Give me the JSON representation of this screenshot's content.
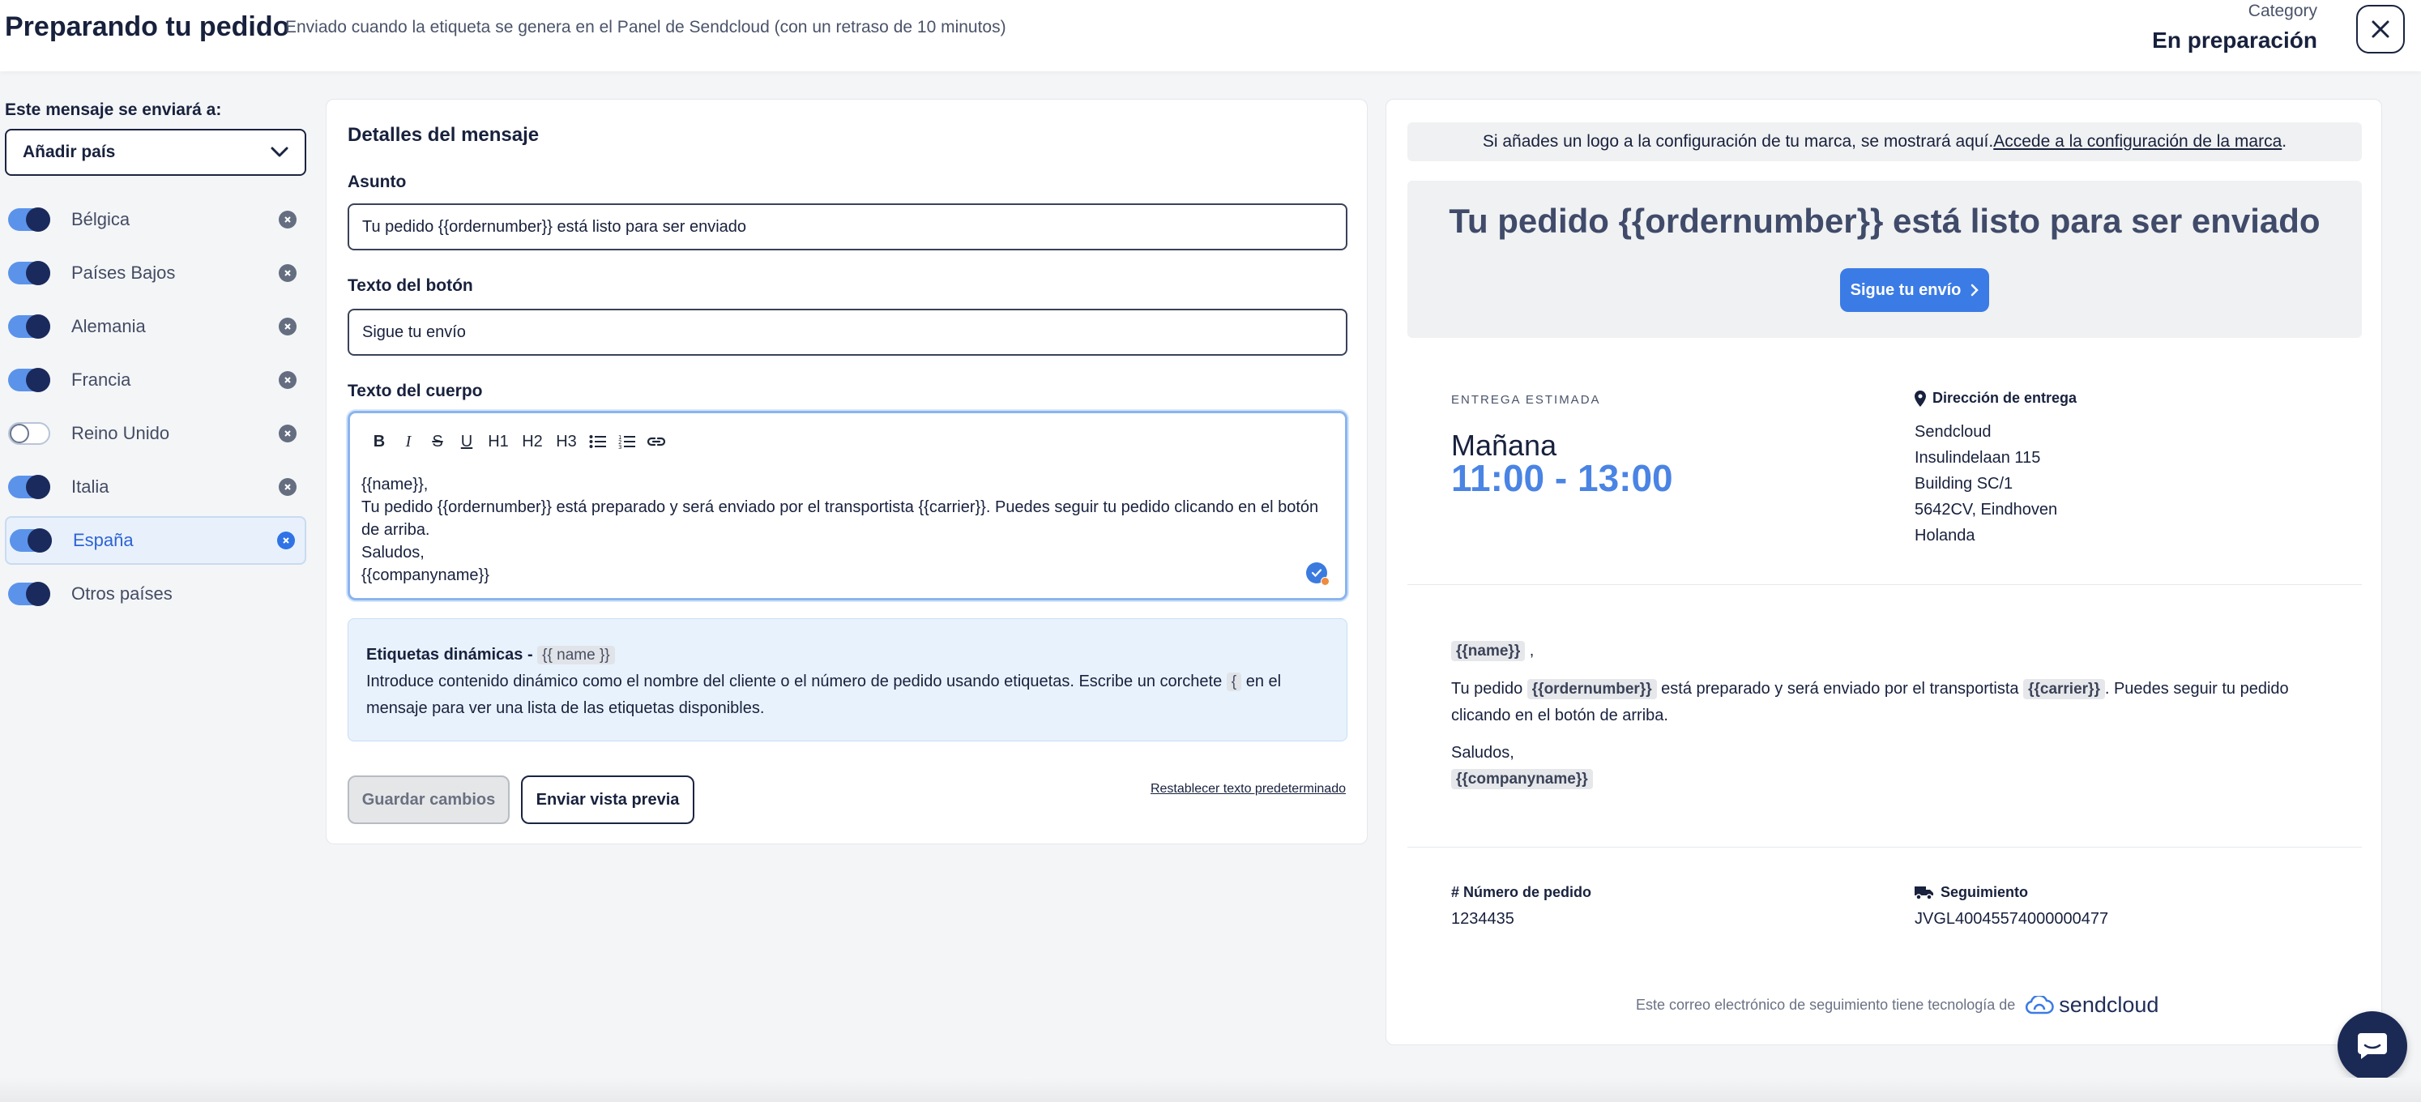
{
  "header": {
    "title": "Preparando tu pedido",
    "subtitle": "Enviado cuando la etiqueta se genera en el Panel de Sendcloud (con un retraso de 10 minutos)",
    "category_label": "Category",
    "category_value": "En preparación",
    "close_icon": "close-icon"
  },
  "sidebar": {
    "send_to_label": "Este mensaje se enviará a:",
    "add_country": "Añadir país",
    "countries": [
      {
        "name": "Bélgica",
        "enabled": true,
        "selected": false
      },
      {
        "name": "Países Bajos",
        "enabled": true,
        "selected": false
      },
      {
        "name": "Alemania",
        "enabled": true,
        "selected": false
      },
      {
        "name": "Francia",
        "enabled": true,
        "selected": false
      },
      {
        "name": "Reino Unido",
        "enabled": false,
        "selected": false
      },
      {
        "name": "Italia",
        "enabled": true,
        "selected": false
      },
      {
        "name": "España",
        "enabled": true,
        "selected": true
      },
      {
        "name": "Otros países",
        "enabled": true,
        "selected": false
      }
    ]
  },
  "details": {
    "title": "Detalles del mensaje",
    "subject_label": "Asunto",
    "subject_value": "Tu pedido {{ordernumber}} está listo para ser enviado",
    "button_label": "Texto del botón",
    "button_value": "Sigue tu envío",
    "body_label": "Texto del cuerpo",
    "toolbar": [
      "B",
      "I",
      "S",
      "U",
      "H1",
      "H2",
      "H3",
      "bullet-list",
      "numbered-list",
      "link"
    ],
    "body_lines": [
      "{{name}},",
      "Tu pedido {{ordernumber}} está preparado y será enviado por el transportista {{carrier}}. Puedes seguir tu pedido clicando en el botón de arriba.",
      "Saludos,",
      "{{companyname}}"
    ],
    "dynamic_title": "Etiquetas dinámicas - ",
    "dynamic_chip": "{{ name }}",
    "dynamic_text_a": "Introduce contenido dinámico como el nombre del cliente o el número de pedido usando etiquetas. Escribe un corchete ",
    "dynamic_brace": "{",
    "dynamic_text_b": " en el mensaje para ver una lista de las etiquetas disponibles.",
    "save_label": "Guardar cambios",
    "preview_label": "Enviar vista previa",
    "reset_label": "Restablecer texto predeterminado"
  },
  "preview": {
    "logo_notice_text": "Si añades un logo a la configuración de tu marca, se mostrará aquí. ",
    "logo_notice_link": "Accede a la configuración de la marca",
    "logo_notice_end": ".",
    "hero_title": "Tu pedido {{ordernumber}} está listo para ser enviado",
    "hero_button": "Sigue tu envío",
    "eta_label": "ENTREGA ESTIMADA",
    "eta_day": "Mañana",
    "eta_time": "11:00 - 13:00",
    "address_label": "Dirección de entrega",
    "address_lines": [
      "Sendcloud",
      "Insulindelaan 115",
      "Building SC/1",
      "5642CV, Eindhoven",
      "Holanda"
    ],
    "body_name": "{{name}}",
    "body_name_after": " ,",
    "body_p_a": "Tu pedido ",
    "body_ordernumber": "{{ordernumber}}",
    "body_p_b": " está preparado y será enviado por el transportista ",
    "body_carrier": "{{carrier}}",
    "body_p_c": ". Puedes seguir tu pedido clicando en el botón de arriba.",
    "body_greeting": "Saludos,",
    "body_companyname": "{{companyname}}",
    "order_label": "# Número de pedido",
    "order_value": "1234435",
    "tracking_label": "Seguimiento",
    "tracking_value": "JVGL40045574000000477",
    "powered_text": "Este correo electrónico de seguimiento tiene tecnología de",
    "brand_name": "sendcloud"
  },
  "colors": {
    "accent": "#3b7be5",
    "navy": "#1b2a5c",
    "selected_bg": "#e8f1fb"
  }
}
